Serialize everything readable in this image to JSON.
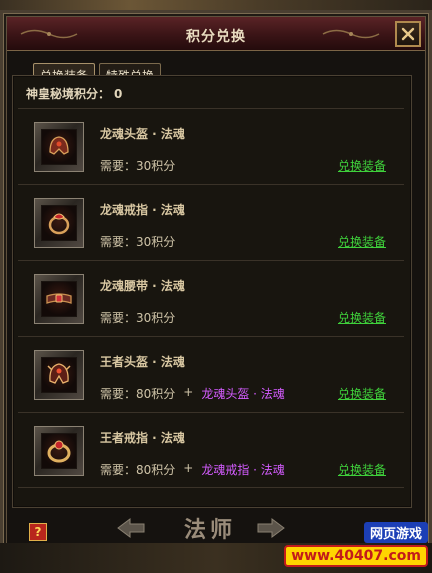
{
  "dialog": {
    "title": "积分兑换"
  },
  "tabs": [
    {
      "label": "兑换装备",
      "active": true
    },
    {
      "label": "特殊兑换",
      "active": false
    }
  ],
  "points": {
    "label": "神皇秘境积分：",
    "value": "0"
  },
  "items": [
    {
      "name": "龙魂头盔 · 法魂",
      "cost": "需要：30积分",
      "plus": "",
      "need": "",
      "action": "兑换装备",
      "icon": "helmet-icon"
    },
    {
      "name": "龙魂戒指 · 法魂",
      "cost": "需要：30积分",
      "plus": "",
      "need": "",
      "action": "兑换装备",
      "icon": "ring-icon"
    },
    {
      "name": "龙魂腰带 · 法魂",
      "cost": "需要：30积分",
      "plus": "",
      "need": "",
      "action": "兑换装备",
      "icon": "belt-icon"
    },
    {
      "name": "王者头盔 · 法魂",
      "cost": "需要：80积分",
      "plus": "+",
      "need": "龙魂头盔 · 法魂",
      "action": "兑换装备",
      "icon": "helmet-icon"
    },
    {
      "name": "王者戒指 · 法魂",
      "cost": "需要：80积分",
      "plus": "+",
      "need": "龙魂戒指 · 法魂",
      "action": "兑换装备",
      "icon": "ring-icon"
    }
  ],
  "footer": {
    "help": "?",
    "class_label": "法师"
  },
  "watermark": {
    "top": "网页游戏",
    "bottom": "www.40407.com"
  },
  "colors": {
    "accent_green": "#3fd13b",
    "need_purple": "#d45cff",
    "title_red": "#5a2326"
  }
}
